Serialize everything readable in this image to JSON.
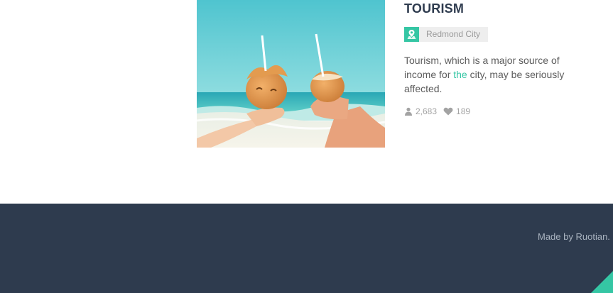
{
  "article": {
    "title": "TOURISM",
    "location": "Redmond City",
    "description": {
      "before": "Tourism, which is a major source of income for ",
      "highlight": "the",
      "after": " city, may be seriously affected."
    },
    "stats": {
      "views": "2,683",
      "likes": "189"
    },
    "image": {
      "subject": "two hands holding coconut drinks with straws on a beach"
    }
  },
  "footer": {
    "made_by_prefix": "Made by ",
    "author": "Ruotian",
    "made_by_suffix": ". "
  },
  "colors": {
    "accent": "#35c6a4",
    "footer_bg": "#2e3b4e",
    "title": "#2f3c4f",
    "body_text": "#5c5c5c",
    "muted": "#a3a3a3"
  },
  "icons": {
    "location": "map-pin-icon",
    "views": "user-icon",
    "likes": "heart-icon",
    "back_to_top": "corner-triangle"
  }
}
